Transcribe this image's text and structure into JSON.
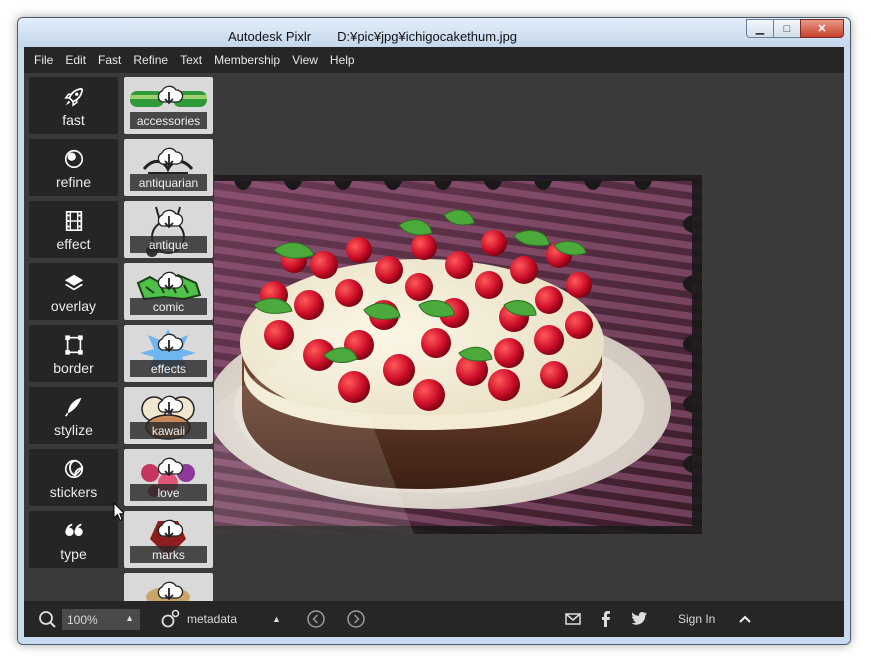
{
  "window": {
    "title": "Autodesk Pixlr　　D:¥pic¥jpg¥ichigocakethum.jpg",
    "minimize_glyph": "▁",
    "maximize_glyph": "□",
    "close_glyph": "✕"
  },
  "menu": [
    "File",
    "Edit",
    "Fast",
    "Refine",
    "Text",
    "Membership",
    "View",
    "Help"
  ],
  "sidebar": {
    "items": [
      {
        "label": "fast",
        "icon": "rocket-icon"
      },
      {
        "label": "refine",
        "icon": "circles-icon"
      },
      {
        "label": "effect",
        "icon": "film-icon"
      },
      {
        "label": "overlay",
        "icon": "layers-icon"
      },
      {
        "label": "border",
        "icon": "border-frame-icon"
      },
      {
        "label": "stylize",
        "icon": "feather-pen-icon"
      },
      {
        "label": "stickers",
        "icon": "sticker-icon"
      },
      {
        "label": "type",
        "icon": "quote-icon"
      }
    ]
  },
  "packs": {
    "items": [
      {
        "label": "accessories"
      },
      {
        "label": "antiquarian"
      },
      {
        "label": "antique"
      },
      {
        "label": "comic"
      },
      {
        "label": "effects"
      },
      {
        "label": "kawaii"
      },
      {
        "label": "love"
      },
      {
        "label": "marks"
      },
      {
        "label": ""
      }
    ]
  },
  "status": {
    "zoom": "100%",
    "metadata_label": "metadata",
    "sign_in": "Sign In",
    "icons": [
      "zoom-search-icon",
      "metadata-icon",
      "caret-up-icon",
      "prev-circle-icon",
      "next-circle-icon",
      "mail-icon",
      "facebook-icon",
      "twitter-icon",
      "chevron-up-icon"
    ]
  },
  "colors": {
    "app_background": "#3a3a3a",
    "panel": "#252525",
    "menubar": "#262626",
    "thumb_background": "#d9d9d9",
    "text": "#ececec",
    "window_frame": "#c9dbee"
  }
}
